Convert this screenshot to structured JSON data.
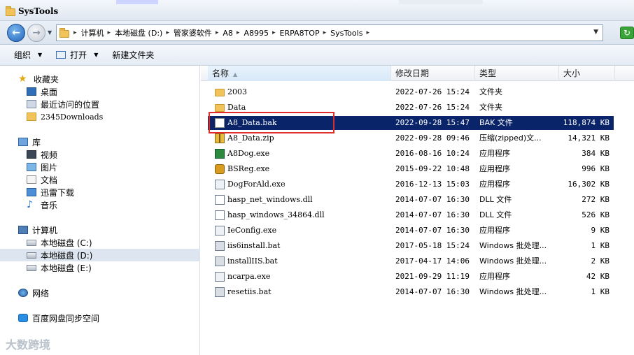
{
  "window": {
    "title": "SysTools"
  },
  "address": {
    "crumbs": [
      "计算机",
      "本地磁盘 (D:)",
      "管家婆软件",
      "A8",
      "A8995",
      "ERPA8TOP",
      "SysTools"
    ]
  },
  "toolbar": {
    "organize": "组织",
    "open": "打开",
    "new_folder": "新建文件夹"
  },
  "nav": {
    "favorites": "收藏夹",
    "desktop": "桌面",
    "recent": "最近访问的位置",
    "downloads": "2345Downloads",
    "libraries": "库",
    "videos": "视频",
    "pictures": "图片",
    "documents": "文档",
    "thunder": "迅雷下载",
    "music": "音乐",
    "computer": "计算机",
    "drive_c": "本地磁盘 (C:)",
    "drive_d": "本地磁盘 (D:)",
    "drive_e": "本地磁盘 (E:)",
    "network": "网络",
    "baidu": "百度网盘同步空间"
  },
  "columns": {
    "name": "名称",
    "date": "修改日期",
    "type": "类型",
    "size": "大小"
  },
  "files": [
    {
      "name": "2003",
      "date": "2022-07-26 15:24",
      "type": "文件夹",
      "size": "",
      "icon": "folder-icon"
    },
    {
      "name": "Data",
      "date": "2022-07-26 15:24",
      "type": "文件夹",
      "size": "",
      "icon": "folder-icon"
    },
    {
      "name": "A8_Data.bak",
      "date": "2022-09-28 15:47",
      "type": "BAK 文件",
      "size": "118,874 KB",
      "icon": "bak-file-icon"
    },
    {
      "name": "A8_Data.zip",
      "date": "2022-09-28 09:46",
      "type": "压缩(zipped)文...",
      "size": "14,321 KB",
      "icon": "zip-file-icon"
    },
    {
      "name": "A8Dog.exe",
      "date": "2016-08-16 10:24",
      "type": "应用程序",
      "size": "384 KB",
      "icon": "a8dog-app-icon"
    },
    {
      "name": "BSReg.exe",
      "date": "2015-09-22 10:48",
      "type": "应用程序",
      "size": "996 KB",
      "icon": "bsreg-app-icon"
    },
    {
      "name": "DogForAld.exe",
      "date": "2016-12-13 15:03",
      "type": "应用程序",
      "size": "16,302 KB",
      "icon": "exe-icon"
    },
    {
      "name": "hasp_net_windows.dll",
      "date": "2014-07-07 16:30",
      "type": "DLL 文件",
      "size": "272 KB",
      "icon": "dll-icon"
    },
    {
      "name": "hasp_windows_34864.dll",
      "date": "2014-07-07 16:30",
      "type": "DLL 文件",
      "size": "526 KB",
      "icon": "dll-icon"
    },
    {
      "name": "IeConfig.exe",
      "date": "2014-07-07 16:30",
      "type": "应用程序",
      "size": "9 KB",
      "icon": "exe-icon"
    },
    {
      "name": "iis6install.bat",
      "date": "2017-05-18 15:24",
      "type": "Windows 批处理...",
      "size": "1 KB",
      "icon": "bat-icon"
    },
    {
      "name": "installIIS.bat",
      "date": "2017-04-17 14:06",
      "type": "Windows 批处理...",
      "size": "2 KB",
      "icon": "bat-icon"
    },
    {
      "name": "ncarpa.exe",
      "date": "2021-09-29 11:19",
      "type": "应用程序",
      "size": "42 KB",
      "icon": "exe-icon"
    },
    {
      "name": "resetiis.bat",
      "date": "2014-07-07 16:30",
      "type": "Windows 批处理...",
      "size": "1 KB",
      "icon": "bat-icon"
    }
  ],
  "selected_file": "A8_Data.bak",
  "watermark": "大数跨境"
}
